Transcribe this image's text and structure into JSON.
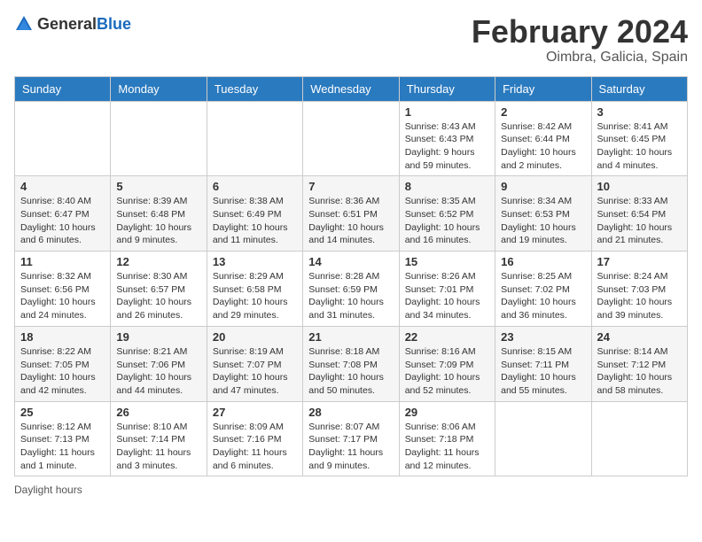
{
  "header": {
    "logo_general": "General",
    "logo_blue": "Blue",
    "title": "February 2024",
    "location": "Oimbra, Galicia, Spain"
  },
  "days_of_week": [
    "Sunday",
    "Monday",
    "Tuesday",
    "Wednesday",
    "Thursday",
    "Friday",
    "Saturday"
  ],
  "weeks": [
    [
      {
        "day": "",
        "info": ""
      },
      {
        "day": "",
        "info": ""
      },
      {
        "day": "",
        "info": ""
      },
      {
        "day": "",
        "info": ""
      },
      {
        "day": "1",
        "info": "Sunrise: 8:43 AM\nSunset: 6:43 PM\nDaylight: 9 hours and 59 minutes."
      },
      {
        "day": "2",
        "info": "Sunrise: 8:42 AM\nSunset: 6:44 PM\nDaylight: 10 hours and 2 minutes."
      },
      {
        "day": "3",
        "info": "Sunrise: 8:41 AM\nSunset: 6:45 PM\nDaylight: 10 hours and 4 minutes."
      }
    ],
    [
      {
        "day": "4",
        "info": "Sunrise: 8:40 AM\nSunset: 6:47 PM\nDaylight: 10 hours and 6 minutes."
      },
      {
        "day": "5",
        "info": "Sunrise: 8:39 AM\nSunset: 6:48 PM\nDaylight: 10 hours and 9 minutes."
      },
      {
        "day": "6",
        "info": "Sunrise: 8:38 AM\nSunset: 6:49 PM\nDaylight: 10 hours and 11 minutes."
      },
      {
        "day": "7",
        "info": "Sunrise: 8:36 AM\nSunset: 6:51 PM\nDaylight: 10 hours and 14 minutes."
      },
      {
        "day": "8",
        "info": "Sunrise: 8:35 AM\nSunset: 6:52 PM\nDaylight: 10 hours and 16 minutes."
      },
      {
        "day": "9",
        "info": "Sunrise: 8:34 AM\nSunset: 6:53 PM\nDaylight: 10 hours and 19 minutes."
      },
      {
        "day": "10",
        "info": "Sunrise: 8:33 AM\nSunset: 6:54 PM\nDaylight: 10 hours and 21 minutes."
      }
    ],
    [
      {
        "day": "11",
        "info": "Sunrise: 8:32 AM\nSunset: 6:56 PM\nDaylight: 10 hours and 24 minutes."
      },
      {
        "day": "12",
        "info": "Sunrise: 8:30 AM\nSunset: 6:57 PM\nDaylight: 10 hours and 26 minutes."
      },
      {
        "day": "13",
        "info": "Sunrise: 8:29 AM\nSunset: 6:58 PM\nDaylight: 10 hours and 29 minutes."
      },
      {
        "day": "14",
        "info": "Sunrise: 8:28 AM\nSunset: 6:59 PM\nDaylight: 10 hours and 31 minutes."
      },
      {
        "day": "15",
        "info": "Sunrise: 8:26 AM\nSunset: 7:01 PM\nDaylight: 10 hours and 34 minutes."
      },
      {
        "day": "16",
        "info": "Sunrise: 8:25 AM\nSunset: 7:02 PM\nDaylight: 10 hours and 36 minutes."
      },
      {
        "day": "17",
        "info": "Sunrise: 8:24 AM\nSunset: 7:03 PM\nDaylight: 10 hours and 39 minutes."
      }
    ],
    [
      {
        "day": "18",
        "info": "Sunrise: 8:22 AM\nSunset: 7:05 PM\nDaylight: 10 hours and 42 minutes."
      },
      {
        "day": "19",
        "info": "Sunrise: 8:21 AM\nSunset: 7:06 PM\nDaylight: 10 hours and 44 minutes."
      },
      {
        "day": "20",
        "info": "Sunrise: 8:19 AM\nSunset: 7:07 PM\nDaylight: 10 hours and 47 minutes."
      },
      {
        "day": "21",
        "info": "Sunrise: 8:18 AM\nSunset: 7:08 PM\nDaylight: 10 hours and 50 minutes."
      },
      {
        "day": "22",
        "info": "Sunrise: 8:16 AM\nSunset: 7:09 PM\nDaylight: 10 hours and 52 minutes."
      },
      {
        "day": "23",
        "info": "Sunrise: 8:15 AM\nSunset: 7:11 PM\nDaylight: 10 hours and 55 minutes."
      },
      {
        "day": "24",
        "info": "Sunrise: 8:14 AM\nSunset: 7:12 PM\nDaylight: 10 hours and 58 minutes."
      }
    ],
    [
      {
        "day": "25",
        "info": "Sunrise: 8:12 AM\nSunset: 7:13 PM\nDaylight: 11 hours and 1 minute."
      },
      {
        "day": "26",
        "info": "Sunrise: 8:10 AM\nSunset: 7:14 PM\nDaylight: 11 hours and 3 minutes."
      },
      {
        "day": "27",
        "info": "Sunrise: 8:09 AM\nSunset: 7:16 PM\nDaylight: 11 hours and 6 minutes."
      },
      {
        "day": "28",
        "info": "Sunrise: 8:07 AM\nSunset: 7:17 PM\nDaylight: 11 hours and 9 minutes."
      },
      {
        "day": "29",
        "info": "Sunrise: 8:06 AM\nSunset: 7:18 PM\nDaylight: 11 hours and 12 minutes."
      },
      {
        "day": "",
        "info": ""
      },
      {
        "day": "",
        "info": ""
      }
    ]
  ],
  "footer": {
    "daylight_label": "Daylight hours"
  }
}
